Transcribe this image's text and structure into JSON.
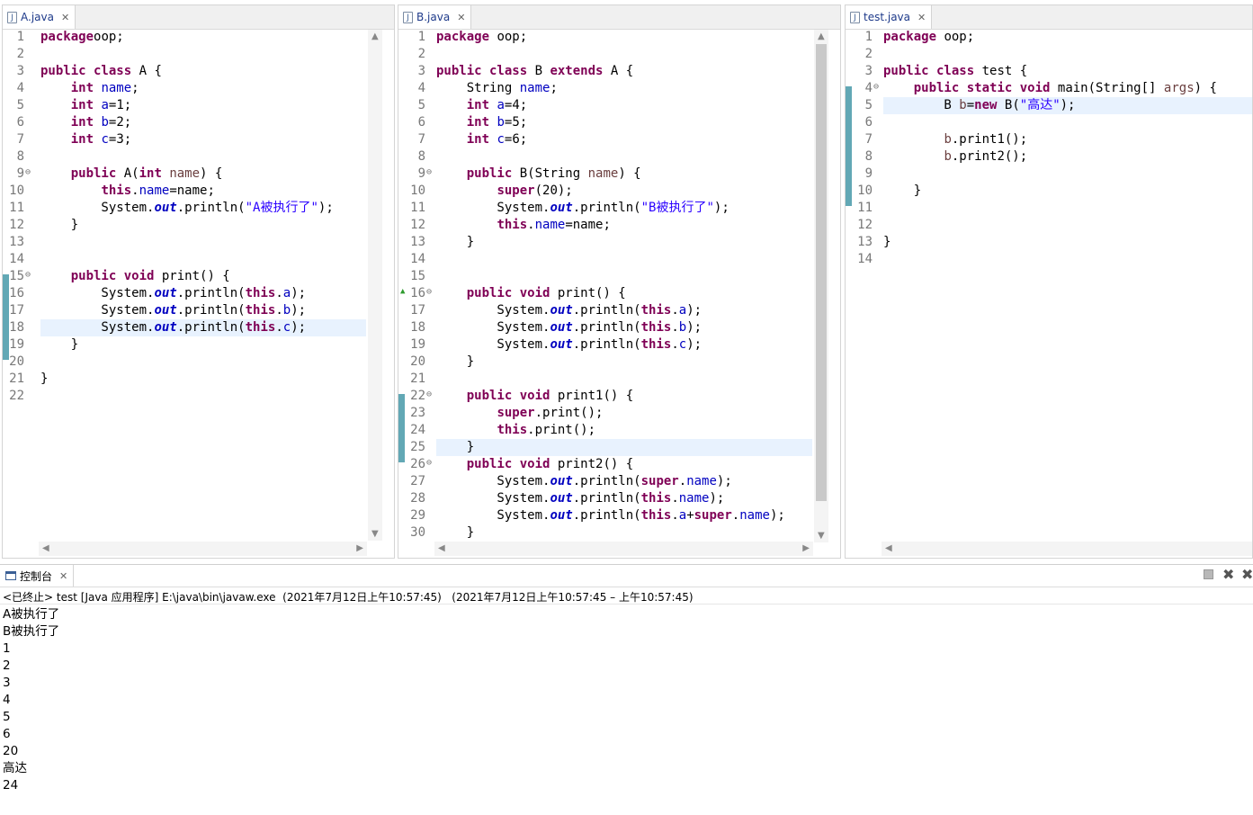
{
  "editors": [
    {
      "tab": "A.java",
      "lines": [
        [
          [
            "kw",
            "package"
          ],
          [
            "",
            "oop;"
          ]
        ],
        [],
        [
          [
            "kw",
            "public"
          ],
          [
            "kw",
            " class"
          ],
          [
            "",
            " A {"
          ]
        ],
        [
          [
            "",
            "    "
          ],
          [
            "kw",
            "int"
          ],
          [
            "",
            " "
          ],
          [
            "fd",
            "name"
          ],
          [
            "",
            ";"
          ]
        ],
        [
          [
            "",
            "    "
          ],
          [
            "kw",
            "int"
          ],
          [
            "",
            " "
          ],
          [
            "fd",
            "a"
          ],
          [
            "",
            "=1;"
          ]
        ],
        [
          [
            "",
            "    "
          ],
          [
            "kw",
            "int"
          ],
          [
            "",
            " "
          ],
          [
            "fd",
            "b"
          ],
          [
            "",
            "=2;"
          ]
        ],
        [
          [
            "",
            "    "
          ],
          [
            "kw",
            "int"
          ],
          [
            "",
            " "
          ],
          [
            "fd",
            "c"
          ],
          [
            "",
            "=3;"
          ]
        ],
        [],
        [
          [
            "",
            "    "
          ],
          [
            "kw",
            "public"
          ],
          [
            "",
            " A("
          ],
          [
            "kw",
            "int"
          ],
          [
            "",
            " "
          ],
          [
            "pm",
            "name"
          ],
          [
            "",
            ") {"
          ]
        ],
        [
          [
            "",
            "        "
          ],
          [
            "kw",
            "this"
          ],
          [
            "",
            "."
          ],
          [
            "fd",
            "name"
          ],
          [
            "",
            "=name;"
          ]
        ],
        [
          [
            "",
            "        System."
          ],
          [
            "it",
            "out"
          ],
          [
            "",
            ".println("
          ],
          [
            "st",
            "\"A被执行了\""
          ],
          [
            "",
            ");"
          ]
        ],
        [
          [
            "",
            "    }"
          ]
        ],
        [],
        [],
        [
          [
            "",
            "    "
          ],
          [
            "kw",
            "public"
          ],
          [
            "",
            " "
          ],
          [
            "kw",
            "void"
          ],
          [
            "",
            " print() {"
          ]
        ],
        [
          [
            "",
            "        System."
          ],
          [
            "it",
            "out"
          ],
          [
            "",
            ".println("
          ],
          [
            "kw",
            "this"
          ],
          [
            "",
            "."
          ],
          [
            "fd",
            "a"
          ],
          [
            "",
            ");"
          ]
        ],
        [
          [
            "",
            "        System."
          ],
          [
            "it",
            "out"
          ],
          [
            "",
            ".println("
          ],
          [
            "kw",
            "this"
          ],
          [
            "",
            "."
          ],
          [
            "fd",
            "b"
          ],
          [
            "",
            ");"
          ]
        ],
        [
          [
            "",
            "        System."
          ],
          [
            "it",
            "out"
          ],
          [
            "",
            ".println("
          ],
          [
            "kw",
            "this"
          ],
          [
            "",
            "."
          ],
          [
            "fd",
            "c"
          ],
          [
            "",
            ");"
          ]
        ],
        [
          [
            "",
            "    }"
          ]
        ],
        [],
        [
          [
            "",
            "}"
          ]
        ],
        []
      ]
    },
    {
      "tab": "B.java",
      "lines": [
        [
          [
            "kw",
            "package"
          ],
          [
            "",
            " oop;"
          ]
        ],
        [],
        [
          [
            "kw",
            "public"
          ],
          [
            "kw",
            " class"
          ],
          [
            "",
            " B "
          ],
          [
            "kw",
            "extends"
          ],
          [
            "",
            " A {"
          ]
        ],
        [
          [
            "",
            "    String "
          ],
          [
            "fd",
            "name"
          ],
          [
            "",
            ";"
          ]
        ],
        [
          [
            "",
            "    "
          ],
          [
            "kw",
            "int"
          ],
          [
            "",
            " "
          ],
          [
            "fd",
            "a"
          ],
          [
            "",
            "=4;"
          ]
        ],
        [
          [
            "",
            "    "
          ],
          [
            "kw",
            "int"
          ],
          [
            "",
            " "
          ],
          [
            "fd",
            "b"
          ],
          [
            "",
            "=5;"
          ]
        ],
        [
          [
            "",
            "    "
          ],
          [
            "kw",
            "int"
          ],
          [
            "",
            " "
          ],
          [
            "fd",
            "c"
          ],
          [
            "",
            "=6;"
          ]
        ],
        [],
        [
          [
            "",
            "    "
          ],
          [
            "kw",
            "public"
          ],
          [
            "",
            " B(String "
          ],
          [
            "pm",
            "name"
          ],
          [
            "",
            ") {"
          ]
        ],
        [
          [
            "",
            "        "
          ],
          [
            "kw",
            "super"
          ],
          [
            "",
            "(20);"
          ]
        ],
        [
          [
            "",
            "        System."
          ],
          [
            "it",
            "out"
          ],
          [
            "",
            ".println("
          ],
          [
            "st",
            "\"B被执行了\""
          ],
          [
            "",
            ");"
          ]
        ],
        [
          [
            "",
            "        "
          ],
          [
            "kw",
            "this"
          ],
          [
            "",
            "."
          ],
          [
            "fd",
            "name"
          ],
          [
            "",
            "=name;"
          ]
        ],
        [
          [
            "",
            "    }"
          ]
        ],
        [],
        [],
        [
          [
            "",
            "    "
          ],
          [
            "kw",
            "public"
          ],
          [
            "",
            " "
          ],
          [
            "kw",
            "void"
          ],
          [
            "",
            " print() {"
          ]
        ],
        [
          [
            "",
            "        System."
          ],
          [
            "it",
            "out"
          ],
          [
            "",
            ".println("
          ],
          [
            "kw",
            "this"
          ],
          [
            "",
            "."
          ],
          [
            "fd",
            "a"
          ],
          [
            "",
            ");"
          ]
        ],
        [
          [
            "",
            "        System."
          ],
          [
            "it",
            "out"
          ],
          [
            "",
            ".println("
          ],
          [
            "kw",
            "this"
          ],
          [
            "",
            "."
          ],
          [
            "fd",
            "b"
          ],
          [
            "",
            ");"
          ]
        ],
        [
          [
            "",
            "        System."
          ],
          [
            "it",
            "out"
          ],
          [
            "",
            ".println("
          ],
          [
            "kw",
            "this"
          ],
          [
            "",
            "."
          ],
          [
            "fd",
            "c"
          ],
          [
            "",
            ");"
          ]
        ],
        [
          [
            "",
            "    }"
          ]
        ],
        [],
        [
          [
            "",
            "    "
          ],
          [
            "kw",
            "public"
          ],
          [
            "",
            " "
          ],
          [
            "kw",
            "void"
          ],
          [
            "",
            " print1() {"
          ]
        ],
        [
          [
            "",
            "        "
          ],
          [
            "kw",
            "super"
          ],
          [
            "",
            ".print();"
          ]
        ],
        [
          [
            "",
            "        "
          ],
          [
            "kw",
            "this"
          ],
          [
            "",
            ".print();"
          ]
        ],
        [
          [
            "",
            "    }"
          ]
        ],
        [
          [
            "",
            "    "
          ],
          [
            "kw",
            "public"
          ],
          [
            "",
            " "
          ],
          [
            "kw",
            "void"
          ],
          [
            "",
            " print2() {"
          ]
        ],
        [
          [
            "",
            "        System."
          ],
          [
            "it",
            "out"
          ],
          [
            "",
            ".println("
          ],
          [
            "kw",
            "super"
          ],
          [
            "",
            "."
          ],
          [
            "fd",
            "name"
          ],
          [
            "",
            ");"
          ]
        ],
        [
          [
            "",
            "        System."
          ],
          [
            "it",
            "out"
          ],
          [
            "",
            ".println("
          ],
          [
            "kw",
            "this"
          ],
          [
            "",
            "."
          ],
          [
            "fd",
            "name"
          ],
          [
            "",
            ");"
          ]
        ],
        [
          [
            "",
            "        System."
          ],
          [
            "it",
            "out"
          ],
          [
            "",
            ".println("
          ],
          [
            "kw",
            "this"
          ],
          [
            "",
            "."
          ],
          [
            "fd",
            "a"
          ],
          [
            "",
            "+"
          ],
          [
            "kw",
            "super"
          ],
          [
            "",
            "."
          ],
          [
            "fd",
            "name"
          ],
          [
            "",
            ");"
          ]
        ],
        [
          [
            "",
            "    }"
          ]
        ]
      ]
    },
    {
      "tab": "test.java",
      "lines": [
        [
          [
            "kw",
            "package"
          ],
          [
            "",
            " oop;"
          ]
        ],
        [],
        [
          [
            "kw",
            "public"
          ],
          [
            "kw",
            " class"
          ],
          [
            "",
            " test {"
          ]
        ],
        [
          [
            "",
            "    "
          ],
          [
            "kw",
            "public"
          ],
          [
            "",
            " "
          ],
          [
            "kw",
            "static"
          ],
          [
            "",
            " "
          ],
          [
            "kw",
            "void"
          ],
          [
            "",
            " main(String[] "
          ],
          [
            "pm",
            "args"
          ],
          [
            "",
            ") {"
          ]
        ],
        [
          [
            "",
            "        B "
          ],
          [
            "pm",
            "b"
          ],
          [
            "",
            "="
          ],
          [
            "kw",
            "new"
          ],
          [
            "",
            " B("
          ],
          [
            "st",
            "\"高达\""
          ],
          [
            "",
            ");"
          ]
        ],
        [],
        [
          [
            "",
            "        "
          ],
          [
            "pm",
            "b"
          ],
          [
            "",
            ".print1();"
          ]
        ],
        [
          [
            "",
            "        "
          ],
          [
            "pm",
            "b"
          ],
          [
            "",
            ".print2();"
          ]
        ],
        [],
        [
          [
            "",
            "    }"
          ]
        ],
        [],
        [],
        [
          [
            "",
            "}"
          ]
        ],
        []
      ]
    }
  ],
  "console": {
    "tab_label": "控制台",
    "info": "<已终止> test [Java 应用程序] E:\\java\\bin\\javaw.exe  (2021年7月12日上午10:57:45)   (2021年7月12日上午10:57:45 – 上午10:57:45)",
    "output": [
      "A被执行了",
      "B被执行了",
      "1",
      "2",
      "3",
      "4",
      "5",
      "6",
      "20",
      "高达",
      "24"
    ]
  }
}
